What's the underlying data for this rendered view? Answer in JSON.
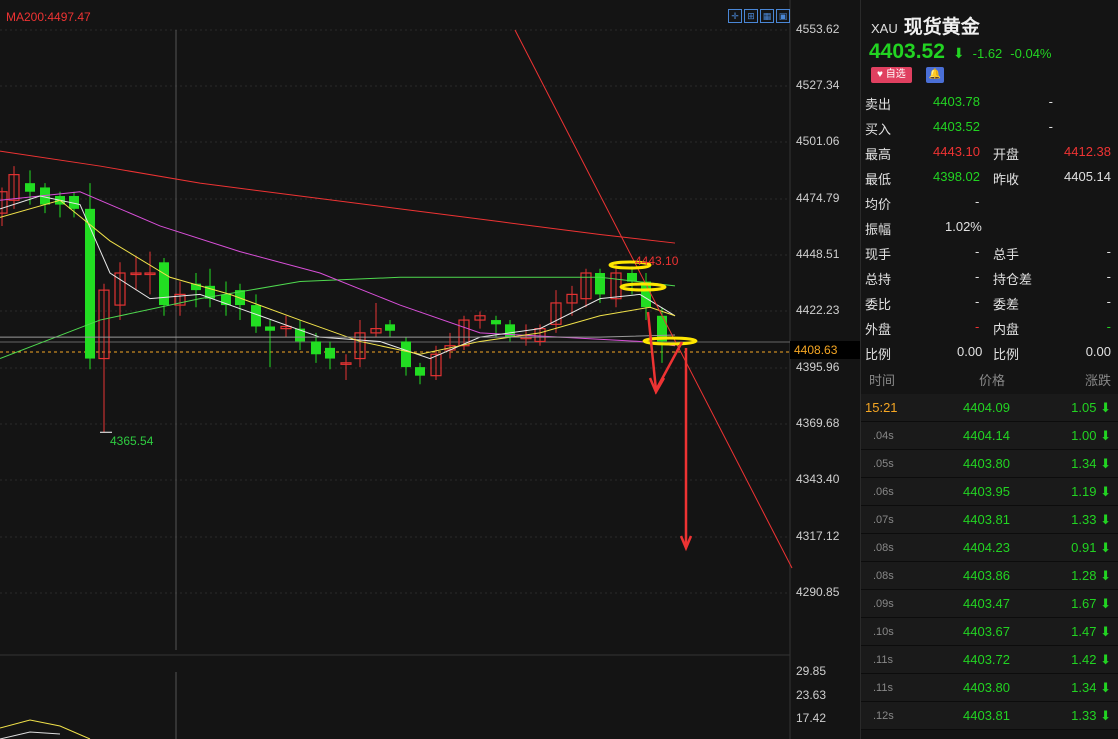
{
  "chart": {
    "ma_label": "MA200:4497.47",
    "current_price_tag": "4408.63",
    "low_label": "4365.54",
    "high_label": "4443.10",
    "axis_ticks": [
      "4553.62",
      "4527.34",
      "4501.06",
      "4474.79",
      "4448.51",
      "4422.23",
      "4395.96",
      "4369.68",
      "4343.40",
      "4317.12",
      "4290.85"
    ],
    "sub_axis_ticks": [
      "29.85",
      "23.63",
      "17.42"
    ],
    "colors": {
      "up": "#e33333",
      "down": "#22dd22",
      "bg": "#141414",
      "ma200": "#e33",
      "ma_white": "#e8e8e8",
      "ma_yellow": "#f1e24a",
      "ma_magenta": "#d94fd9",
      "ma_green": "#4fd94f",
      "ma_gray": "#9a9a9a"
    }
  },
  "panel": {
    "code": "XAU",
    "name": "现货黄金",
    "price": "4403.52",
    "change": "-1.62",
    "change_pct": "-0.04%",
    "watch_label": "♥ 自选",
    "bell_icon": "bell-icon",
    "quotes": [
      {
        "l1": "卖出",
        "v1": "4403.78",
        "c1": "grn",
        "l2": "",
        "v2": "-",
        "c2": "wht"
      },
      {
        "l1": "买入",
        "v1": "4403.52",
        "c1": "grn",
        "l2": "",
        "v2": "-",
        "c2": "wht"
      },
      {
        "l1": "最高",
        "v1": "4443.10",
        "c1": "red",
        "l2": "开盘",
        "v2": "4412.38",
        "c2": "red"
      },
      {
        "l1": "最低",
        "v1": "4398.02",
        "c1": "grn",
        "l2": "昨收",
        "v2": "4405.14",
        "c2": "wht"
      },
      {
        "l1": "均价",
        "v1": "-",
        "c1": "wht",
        "l2": "",
        "v2": "",
        "c2": "wht"
      },
      {
        "l1": "振幅",
        "v1": "1.02%",
        "c1": "wht",
        "l2": "",
        "v2": "",
        "c2": "wht"
      },
      {
        "l1": "现手",
        "v1": "-",
        "c1": "wht",
        "l2": "总手",
        "v2": "-",
        "c2": "wht"
      },
      {
        "l1": "总持",
        "v1": "-",
        "c1": "wht",
        "l2": "持仓差",
        "v2": "-",
        "c2": "wht"
      },
      {
        "l1": "委比",
        "v1": "-",
        "c1": "wht",
        "l2": "委差",
        "v2": "-",
        "c2": "wht"
      },
      {
        "l1": "外盘",
        "v1": "-",
        "c1": "red",
        "l2": "内盘",
        "v2": "-",
        "c2": "grn"
      },
      {
        "l1": "比例",
        "v1": "0.00",
        "c1": "wht",
        "l2": "比例",
        "v2": "0.00",
        "c2": "wht"
      }
    ],
    "tick_header": {
      "time": "时间",
      "price": "价格",
      "change": "涨跌"
    },
    "ticks": [
      {
        "time": "15:21",
        "price": "4404.09",
        "chg": "1.05"
      },
      {
        "time": ".04s",
        "price": "4404.14",
        "chg": "1.00"
      },
      {
        "time": ".05s",
        "price": "4403.80",
        "chg": "1.34"
      },
      {
        "time": ".06s",
        "price": "4403.95",
        "chg": "1.19"
      },
      {
        "time": ".07s",
        "price": "4403.81",
        "chg": "1.33"
      },
      {
        "time": ".08s",
        "price": "4404.23",
        "chg": "0.91"
      },
      {
        "time": ".08s",
        "price": "4403.86",
        "chg": "1.28"
      },
      {
        "time": ".09s",
        "price": "4403.47",
        "chg": "1.67"
      },
      {
        "time": ".10s",
        "price": "4403.67",
        "chg": "1.47"
      },
      {
        "time": ".11s",
        "price": "4403.72",
        "chg": "1.42"
      },
      {
        "time": ".11s",
        "price": "4403.80",
        "chg": "1.34"
      },
      {
        "time": ".12s",
        "price": "4403.81",
        "chg": "1.33"
      }
    ]
  }
}
